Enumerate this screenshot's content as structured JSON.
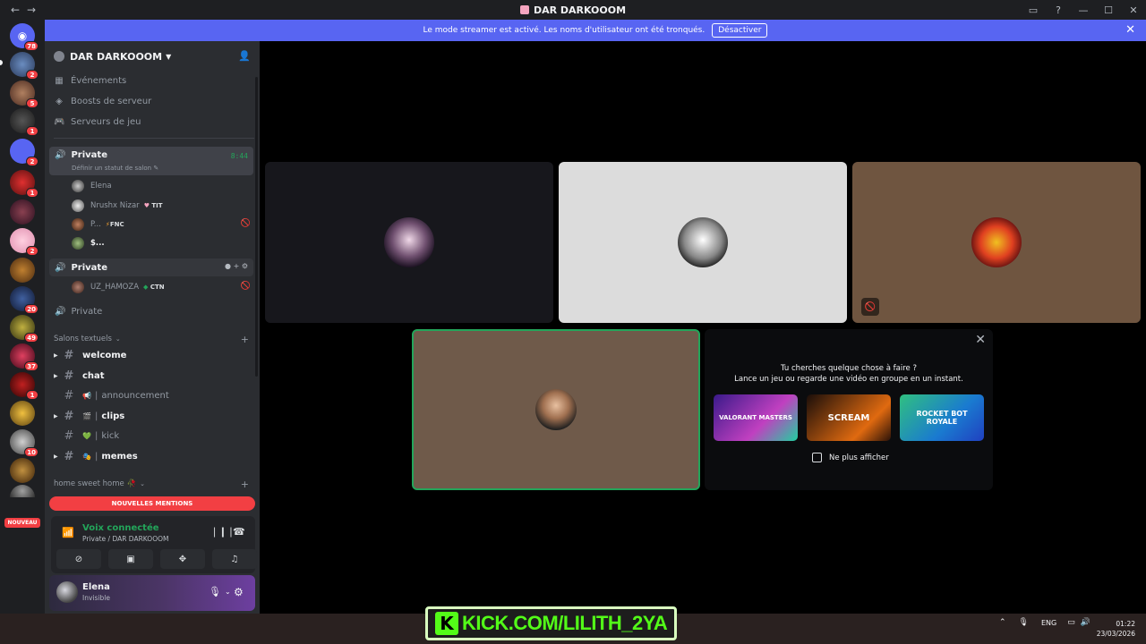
{
  "window": {
    "title": "DAR DARKOOOM",
    "back_glyph": "←",
    "forward_glyph": "→",
    "controls": [
      "▭",
      "?",
      "—",
      "☐",
      "✕"
    ]
  },
  "banner": {
    "text": "Le mode streamer est activé. Les noms d'utilisateur ont été tronqués.",
    "button": "Désactiver",
    "close_glyph": "✕"
  },
  "rail": {
    "badges": [
      "78",
      "2",
      "5",
      "1",
      "2",
      "1",
      "2",
      "20",
      "49",
      "37",
      "1",
      "10"
    ],
    "new_label": "NOUVEAU"
  },
  "guild": {
    "name": "DAR DARKOOOM",
    "nav": [
      {
        "icon": "▦",
        "label": "Événements"
      },
      {
        "icon": "◈",
        "label": "Boosts de serveur"
      },
      {
        "icon": "🎮",
        "label": "Serveurs de jeu"
      }
    ]
  },
  "voice_channels": [
    {
      "name": "Private",
      "time": "8:44",
      "status": "Définir un statut de salon ✎",
      "members": [
        {
          "name": "Elena",
          "tag": ""
        },
        {
          "name": "Nrushx Nizar",
          "tag_glyph": "♥",
          "tag": "TIT"
        },
        {
          "name": "P...",
          "tag_glyph": "⚡",
          "tag": "FNC"
        },
        {
          "name": "$...",
          "tag": ""
        }
      ]
    },
    {
      "name": "Private",
      "members": [
        {
          "name": "UZ_HAMOZA",
          "tag_glyph": "◆",
          "tag": "CTN"
        }
      ]
    },
    {
      "name": "Private"
    }
  ],
  "text_category": {
    "label": "Salons textuels",
    "channels": [
      {
        "name": "welcome",
        "emoji": "",
        "unread": true
      },
      {
        "name": "chat",
        "emoji": "",
        "unread": true
      },
      {
        "name": "announcement",
        "emoji": "📢",
        "unread": false
      },
      {
        "name": "clips",
        "emoji": "🎬",
        "unread": true
      },
      {
        "name": "kick",
        "emoji": "💚",
        "unread": false
      },
      {
        "name": "memes",
        "emoji": "🎭",
        "unread": true
      }
    ]
  },
  "home_category": {
    "label": "home sweet home 🥀"
  },
  "mentions_label": "NOUVELLES MENTIONS",
  "voice_panel": {
    "title": "Voix connectée",
    "subtitle": "Private / DAR DARKOOOM"
  },
  "user": {
    "name": "Elena",
    "status": "Invisible"
  },
  "activity": {
    "title": "Tu cherches quelque chose à faire ?",
    "subtitle": "Lance un jeu ou regarde une vidéo en groupe en un instant.",
    "cards": [
      {
        "name": "VALORANT MASTERS",
        "color": "#6b2bb8"
      },
      {
        "name": "SCREAM",
        "color": "#2a1a14"
      },
      {
        "name": "ROCKET BOT ROYALE",
        "color": "#1a8ad8"
      }
    ],
    "checkbox": "Ne plus afficher"
  },
  "overlay": {
    "kick_text": "KICK.COM/LILITH_2YA",
    "kick_logo": "K"
  },
  "tray": {
    "lang": "ENG",
    "time": "01:22",
    "date": "23/03/2026"
  },
  "colors": {
    "accent": "#5865f2",
    "online": "#23a55a",
    "danger": "#f23f43",
    "kick": "#53fc18"
  }
}
